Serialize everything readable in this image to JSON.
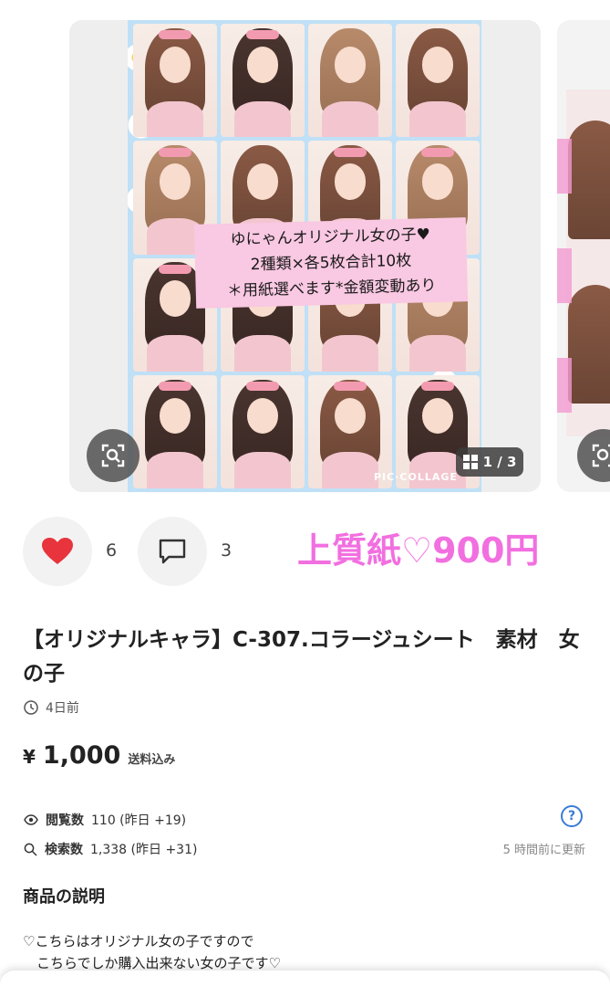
{
  "carousel": {
    "caption_lines": [
      "ゆにゃんオリジナル女の子♥",
      "2種類×各5枚合計10枚",
      "＊用紙選べます*金額変動あり"
    ],
    "watermark": "PIC·COLLAGE",
    "counter": "1 / 3"
  },
  "actions": {
    "likes": "6",
    "comments": "3",
    "promo_text": "上質紙♡900円"
  },
  "item": {
    "title": "【オリジナルキャラ】C-307.コラージュシート　素材　女の子",
    "posted": "4日前",
    "price_currency": "¥",
    "price_amount": "1,000",
    "shipping": "送料込み"
  },
  "stats": {
    "views_label": "閲覧数",
    "views_value": "110 (昨日 +19)",
    "search_label": "検索数",
    "search_value": "1,338 (昨日 +31)",
    "help": "?",
    "updated": "5 時間前に更新"
  },
  "description": {
    "heading": "商品の説明",
    "lines": [
      "♡こちらはオリジナル女の子ですので",
      "　こちらでしか購入出来ない女の子です♡"
    ]
  },
  "colors": {
    "heart": "#e8343c",
    "promo": "#f26fe0",
    "help": "#3a7bd5"
  }
}
